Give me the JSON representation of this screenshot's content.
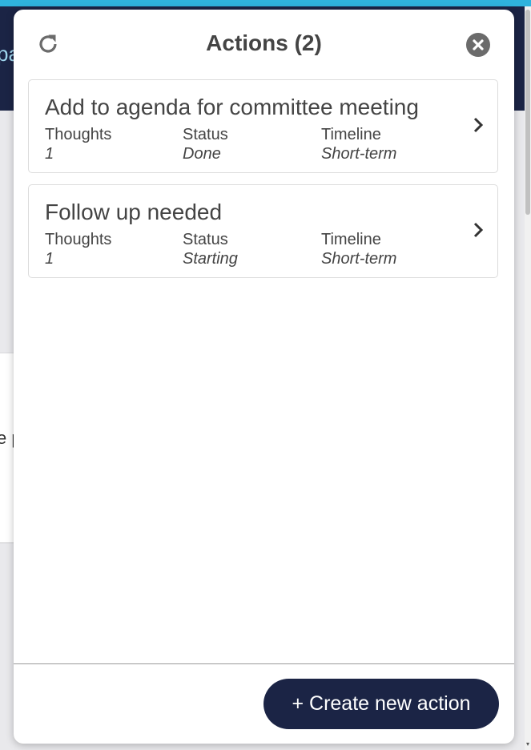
{
  "background": {
    "header_fragment": "pa",
    "body_fragment": "e p"
  },
  "modal": {
    "title": "Actions (2)",
    "refresh_icon": "refresh-icon",
    "close_icon": "close-icon",
    "actions": [
      {
        "title": "Add to agenda for committee meeting",
        "thoughts_label": "Thoughts",
        "thoughts_value": "1",
        "status_label": "Status",
        "status_value": "Done",
        "timeline_label": "Timeline",
        "timeline_value": "Short-term"
      },
      {
        "title": "Follow up needed",
        "thoughts_label": "Thoughts",
        "thoughts_value": "1",
        "status_label": "Status",
        "status_value": "Starting",
        "timeline_label": "Timeline",
        "timeline_value": "Short-term"
      }
    ],
    "create_button_label": "+ Create new action"
  },
  "colors": {
    "header": "#1b2445",
    "top_strip": "#2fb3dd",
    "button": "#1b2445",
    "close_circle": "#6b6b6b"
  }
}
